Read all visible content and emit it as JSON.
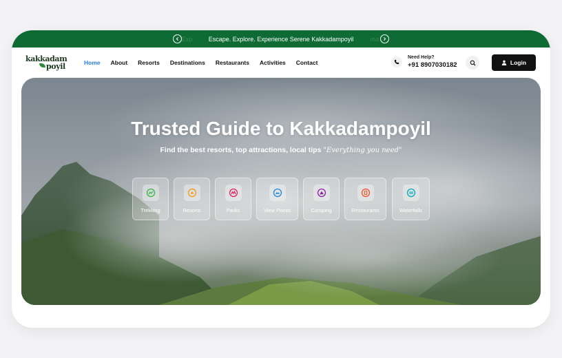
{
  "announcement": {
    "text": "Escape. Explore. Experience Serene Kakkadampoyil",
    "ghost_left": "Exp",
    "ghost_right": "ma"
  },
  "logo": {
    "line1": "kakkadam",
    "line2": "poyil"
  },
  "nav": {
    "items": [
      {
        "label": "Home"
      },
      {
        "label": "About"
      },
      {
        "label": "Resorts"
      },
      {
        "label": "Destinations"
      },
      {
        "label": "Restaurants"
      },
      {
        "label": "Activities"
      },
      {
        "label": "Contact"
      }
    ],
    "active": "Home"
  },
  "help": {
    "label": "Need Help?",
    "phone": "+91 8907030182"
  },
  "login": {
    "label": "Login"
  },
  "hero": {
    "title": "Trusted Guide to Kakkadampoyil",
    "subtitle": "Find the best resorts, top attractions, local tips",
    "quote": "\"Everything you need\""
  },
  "categories": [
    {
      "label": "Trekking",
      "icon": "trekking-icon",
      "color": "#3cb54a"
    },
    {
      "label": "Resorts",
      "icon": "resort-icon",
      "color": "#f39c12"
    },
    {
      "label": "Parks",
      "icon": "park-icon",
      "color": "#e0245e"
    },
    {
      "label": "View Points",
      "icon": "viewpoint-icon",
      "color": "#1e88e5"
    },
    {
      "label": "Camping",
      "icon": "camping-icon",
      "color": "#8e24aa"
    },
    {
      "label": "Restaurants",
      "icon": "restaurant-icon",
      "color": "#f4511e"
    },
    {
      "label": "Waterfalls",
      "icon": "waterfall-icon",
      "color": "#00acc1"
    }
  ],
  "colors": {
    "brand_green": "#0e6b34",
    "accent_blue": "#2a7de1",
    "dark": "#111111"
  }
}
